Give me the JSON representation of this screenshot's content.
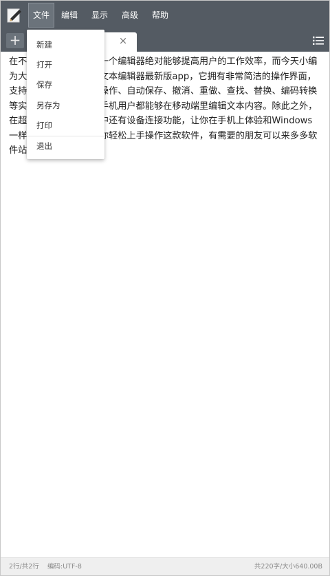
{
  "menubar": {
    "items": [
      {
        "label": "文件",
        "active": true
      },
      {
        "label": "编辑"
      },
      {
        "label": "显示"
      },
      {
        "label": "高级"
      },
      {
        "label": "帮助"
      }
    ]
  },
  "tabbar": {
    "add_label": "+",
    "close_label": "×"
  },
  "file_menu": {
    "items": [
      "新建",
      "打开",
      "保存",
      "另存为",
      "打印",
      "退出"
    ]
  },
  "editor": {
    "text": "在不少场合里面，拥有一个编辑器绝对能够提高用户的工作效率，而今天小编为大家带来的则是超卓文本编辑器最新版app，它拥有非常简洁的操作界面，支持多标签管理、菜单操作、自动保存、撤消、重做、查找、替换、编码转换等实用功能，让每一位手机用户都能够在移动端里编辑文本内容。除此之外，在超卓文本编辑器软件中还有设备连接功能，让你在手机上体验和Windows一样的常用快捷键，让你轻松上手操作这款软件，有需要的朋友可以来多多软件站免费下载。"
  },
  "statusbar": {
    "lines": "2行/共2行",
    "encoding": "编码:UTF-8",
    "size": "共220字/大小640.00B"
  },
  "colors": {
    "toolbar_bg": "#545b63",
    "active_menu_bg": "#6b737b",
    "statusbar_bg": "#efefef"
  }
}
